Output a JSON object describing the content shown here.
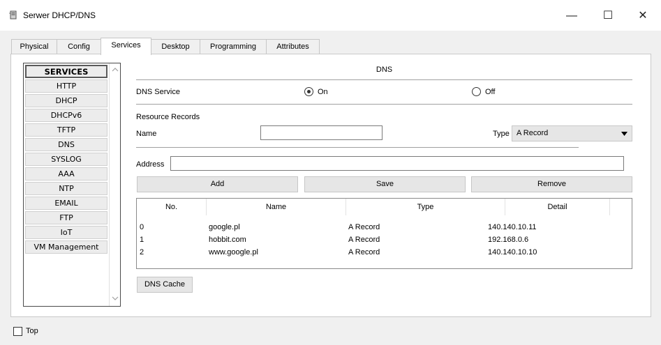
{
  "window": {
    "title": "Serwer DHCP/DNS",
    "minimize": "—",
    "maximize": "☐",
    "close": "✕",
    "icon": "server-tower-icon"
  },
  "tabs": [
    {
      "label": "Physical",
      "active": false
    },
    {
      "label": "Config",
      "active": false
    },
    {
      "label": "Services",
      "active": true
    },
    {
      "label": "Desktop",
      "active": false
    },
    {
      "label": "Programming",
      "active": false
    },
    {
      "label": "Attributes",
      "active": false
    }
  ],
  "services": {
    "header": "SERVICES",
    "items": [
      "HTTP",
      "DHCP",
      "DHCPv6",
      "TFTP",
      "DNS",
      "SYSLOG",
      "AAA",
      "NTP",
      "EMAIL",
      "FTP",
      "IoT",
      "VM Management"
    ]
  },
  "dns": {
    "title": "DNS",
    "service_label": "DNS Service",
    "on_label": "On",
    "off_label": "Off",
    "service_on": true,
    "resource_records_label": "Resource Records",
    "name_label": "Name",
    "name_value": "",
    "type_label": "Type",
    "type_value": "A Record",
    "address_label": "Address",
    "address_value": "",
    "buttons": {
      "add": "Add",
      "save": "Save",
      "remove": "Remove"
    },
    "table": {
      "columns": [
        "No.",
        "Name",
        "Type",
        "Detail"
      ],
      "rows": [
        {
          "no": "0",
          "name": "google.pl",
          "type": "A Record",
          "detail": "140.140.10.11"
        },
        {
          "no": "1",
          "name": "hobbit.com",
          "type": "A Record",
          "detail": "192.168.0.6"
        },
        {
          "no": "2",
          "name": "www.google.pl",
          "type": "A Record",
          "detail": "140.140.10.10"
        }
      ]
    },
    "dns_cache_button": "DNS Cache"
  },
  "footer": {
    "top_label": "Top",
    "top_checked": false
  }
}
